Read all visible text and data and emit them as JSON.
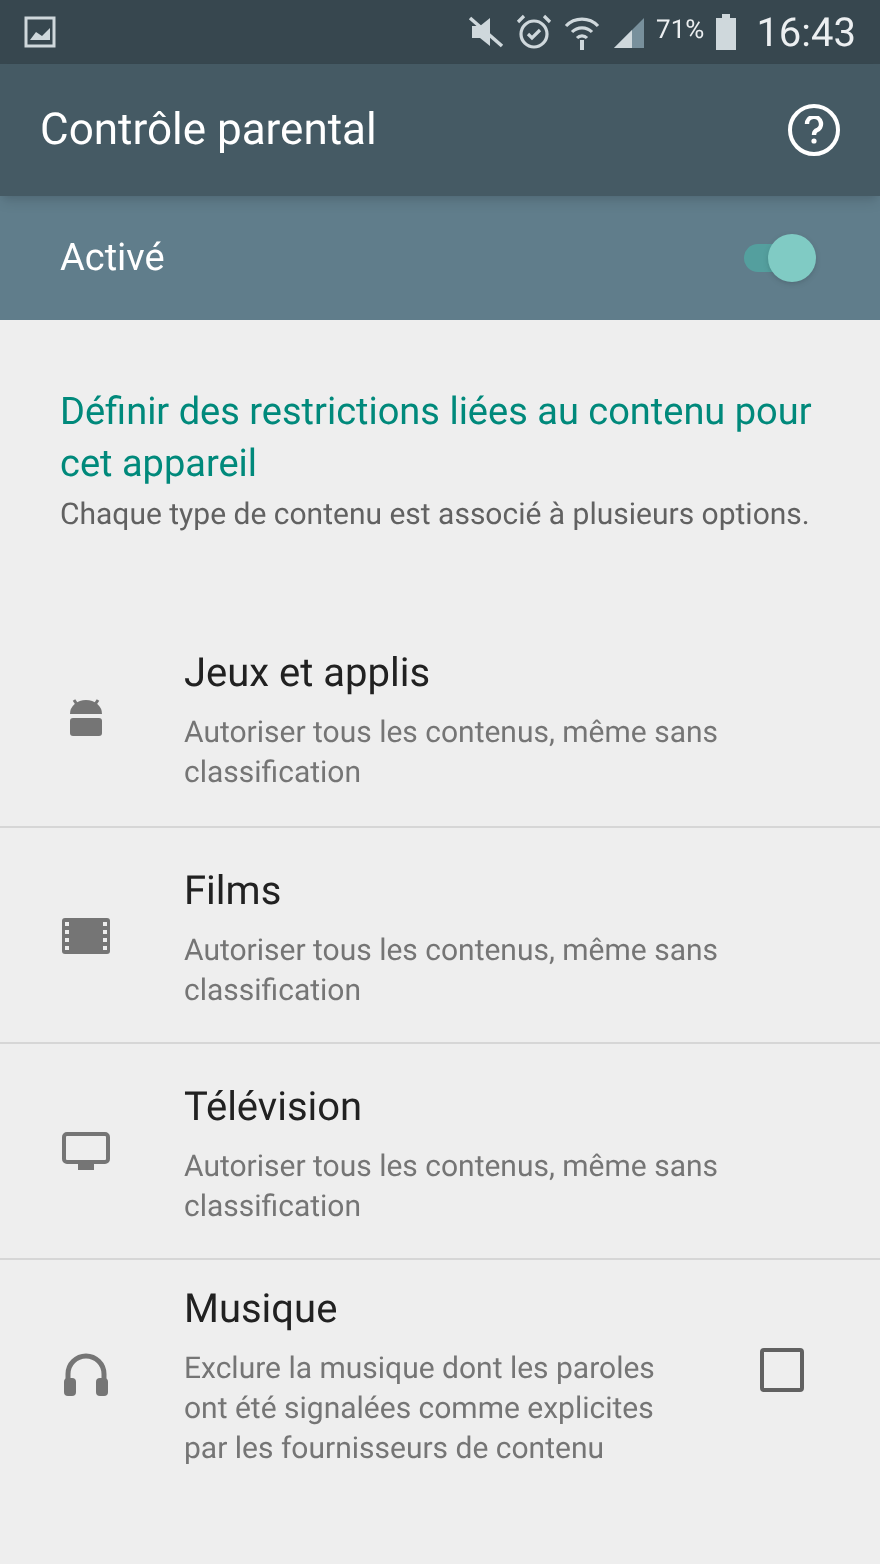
{
  "status_bar": {
    "battery_percent": "71%",
    "time": "16:43"
  },
  "app_bar": {
    "title": "Contrôle parental"
  },
  "master_switch": {
    "label": "Activé",
    "on": true
  },
  "intro": {
    "heading": "Définir des restrictions liées au contenu pour cet appareil",
    "description": "Chaque type de contenu est associé à plusieurs options."
  },
  "items": [
    {
      "kind": "option",
      "title": "Jeux et applis",
      "summary": "Autoriser tous les contenus, même sans classification"
    },
    {
      "kind": "option",
      "title": "Films",
      "summary": "Autoriser tous les contenus, même sans classification"
    },
    {
      "kind": "option",
      "title": "Télévision",
      "summary": "Autoriser tous les contenus, même sans classification"
    },
    {
      "kind": "checkbox",
      "title": "Musique",
      "summary": "Exclure la musique dont les paroles ont été signalées comme explicites par les fournisseurs de contenu",
      "checked": false
    }
  ]
}
